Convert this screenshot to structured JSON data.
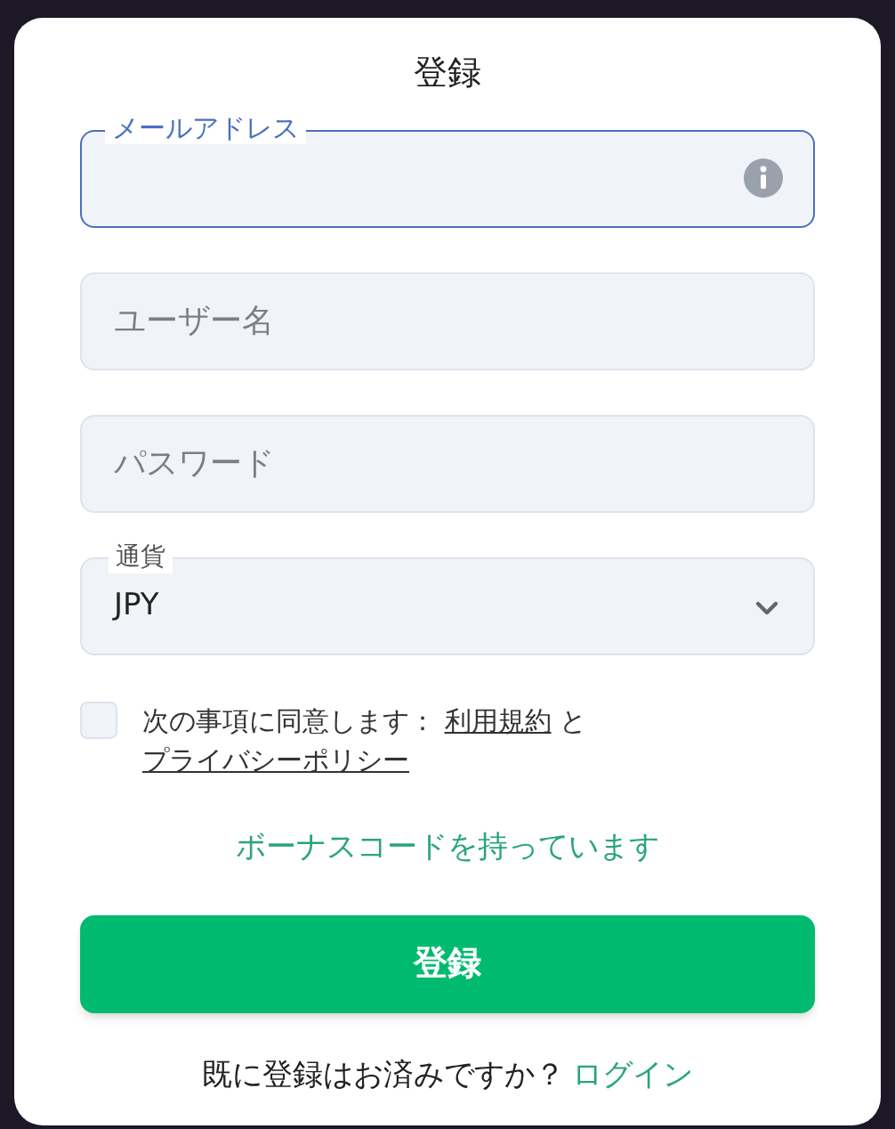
{
  "title": "登録",
  "fields": [
    {
      "kind": "text",
      "label": "メールアドレス",
      "focused": true,
      "info_icon": true
    },
    {
      "kind": "text",
      "placeholder": "ユーザー名",
      "focused": false
    },
    {
      "kind": "text",
      "placeholder": "パスワード",
      "focused": false
    },
    {
      "kind": "select",
      "label": "通貨",
      "value": "JPY",
      "focused": false
    }
  ],
  "consent": {
    "checked": false,
    "text": "次の事項に同意します：",
    "link_1": "利用規約",
    "joiner": "と",
    "link_2": "プライバシーポリシー"
  },
  "bonus_link": "ボーナスコードを持っています",
  "submit_button": "登録",
  "login_prompt": {
    "text": "既に登録はお済みですか？",
    "link": "ログイン"
  }
}
